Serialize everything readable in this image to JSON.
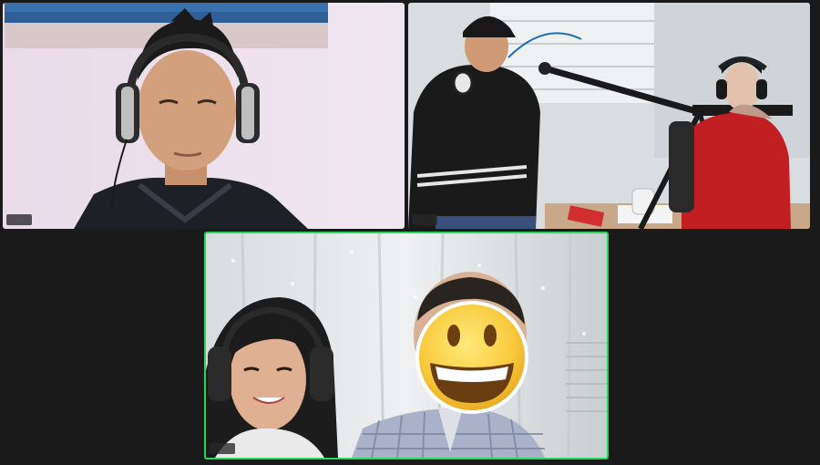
{
  "meeting": {
    "view": "gallery",
    "participants": [
      {
        "tile": "top-left",
        "name_label": "",
        "active_speaker": false,
        "muted": false
      },
      {
        "tile": "top-right",
        "name_label": "",
        "active_speaker": false,
        "muted": false
      },
      {
        "tile": "bottom-center",
        "name_label": "",
        "active_speaker": true,
        "muted": false
      }
    ]
  },
  "colors": {
    "background": "#1a1a1a",
    "active_border": "#23d959"
  },
  "icons": {
    "emoji_overlay": "grinning-face-emoji",
    "mic": "mic-icon"
  }
}
